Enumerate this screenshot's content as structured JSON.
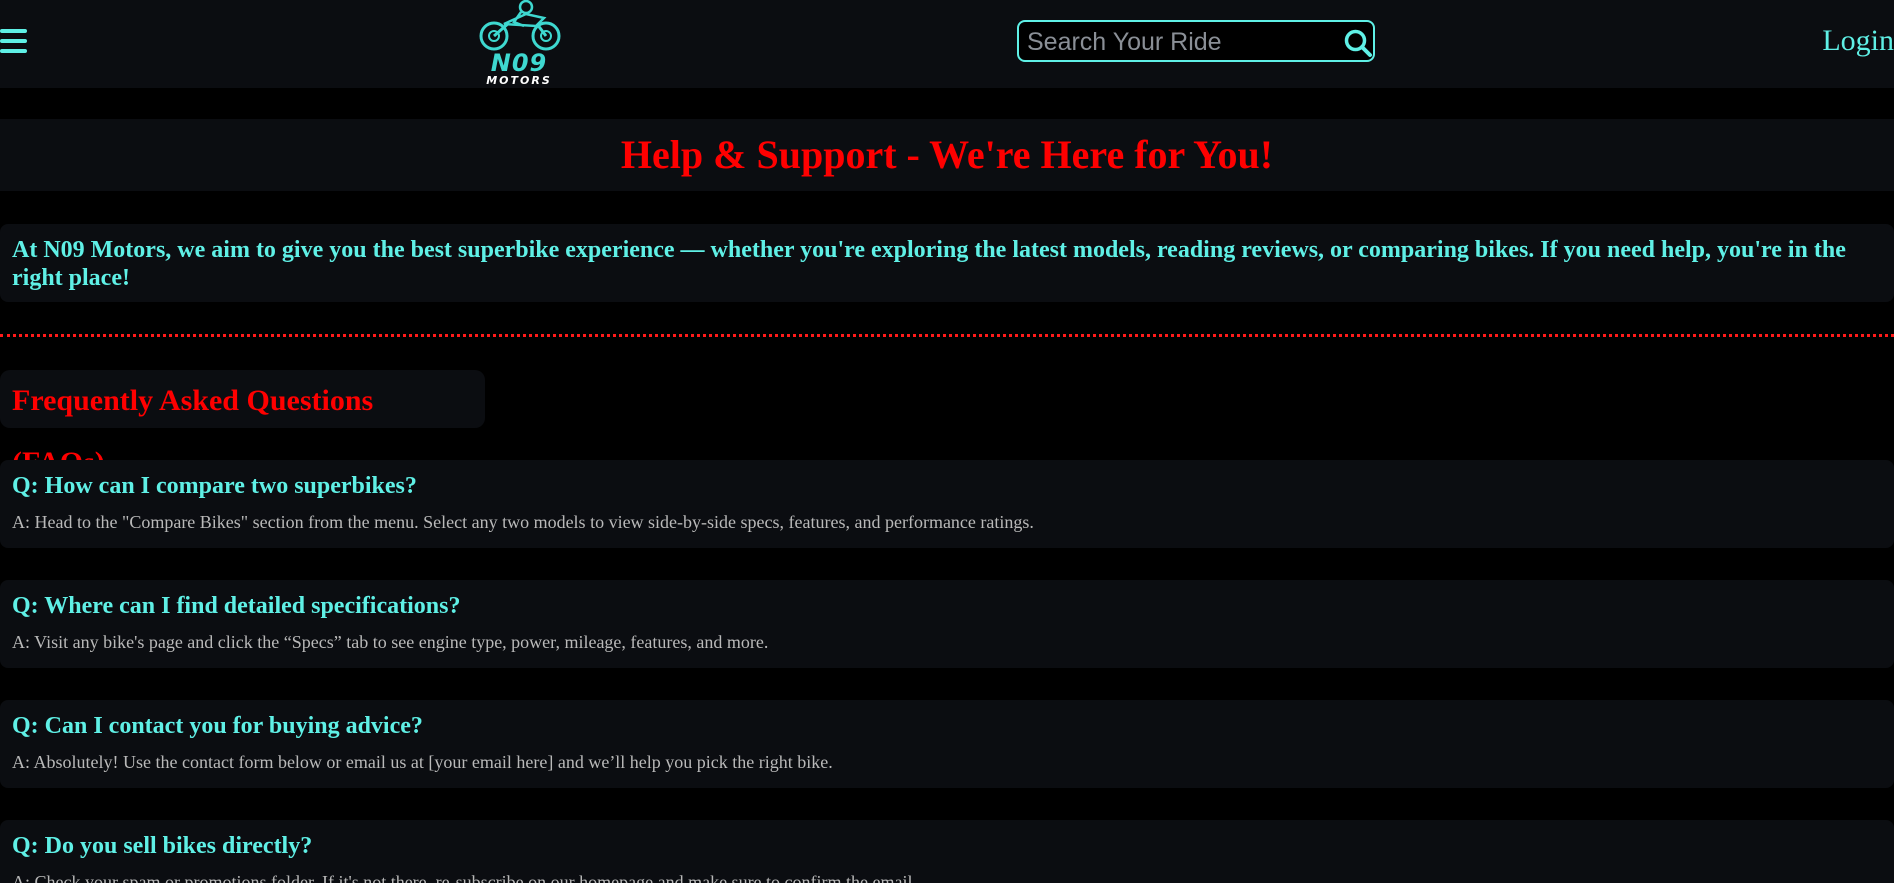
{
  "header": {
    "logo_text": "N09",
    "logo_subtext": "MOTORS",
    "search_placeholder": "Search Your Ride",
    "login_label": "Login"
  },
  "hero": {
    "title": "Help & Support - We're Here for You!"
  },
  "intro": {
    "text": "At N09 Motors, we aim to give you the best superbike experience — whether you're exploring the latest models, reading reviews, or comparing bikes. If you need help, you're in the right place!"
  },
  "faq": {
    "heading": "Frequently Asked Questions (FAQs)",
    "items": [
      {
        "question": "Q: How can I compare two superbikes?",
        "answer": "A: Head to the \"Compare Bikes\" section from the menu. Select any two models to view side-by-side specs, features, and performance ratings."
      },
      {
        "question": "Q: Where can I find detailed specifications?",
        "answer": "A: Visit any bike's page and click the “Specs” tab to see engine type, power, mileage, features, and more."
      },
      {
        "question": "Q: Can I contact you for buying advice?",
        "answer": "A: Absolutely! Use the contact form below or email us at [your email here] and we’ll help you pick the right bike."
      },
      {
        "question": "Q: Do you sell bikes directly?",
        "answer": "A: Check your spam or promotions folder. If it's not there, re-subscribe on our homepage and make sure to confirm the email."
      }
    ]
  },
  "colors": {
    "accent": "#5ff0e6",
    "heading_red": "#ff0000",
    "panel_bg": "#0b0d11",
    "page_bg": "#000000"
  },
  "icons": {
    "menu": "hamburger-menu-icon",
    "logo": "motorbike-rider-icon",
    "search": "search-icon"
  }
}
